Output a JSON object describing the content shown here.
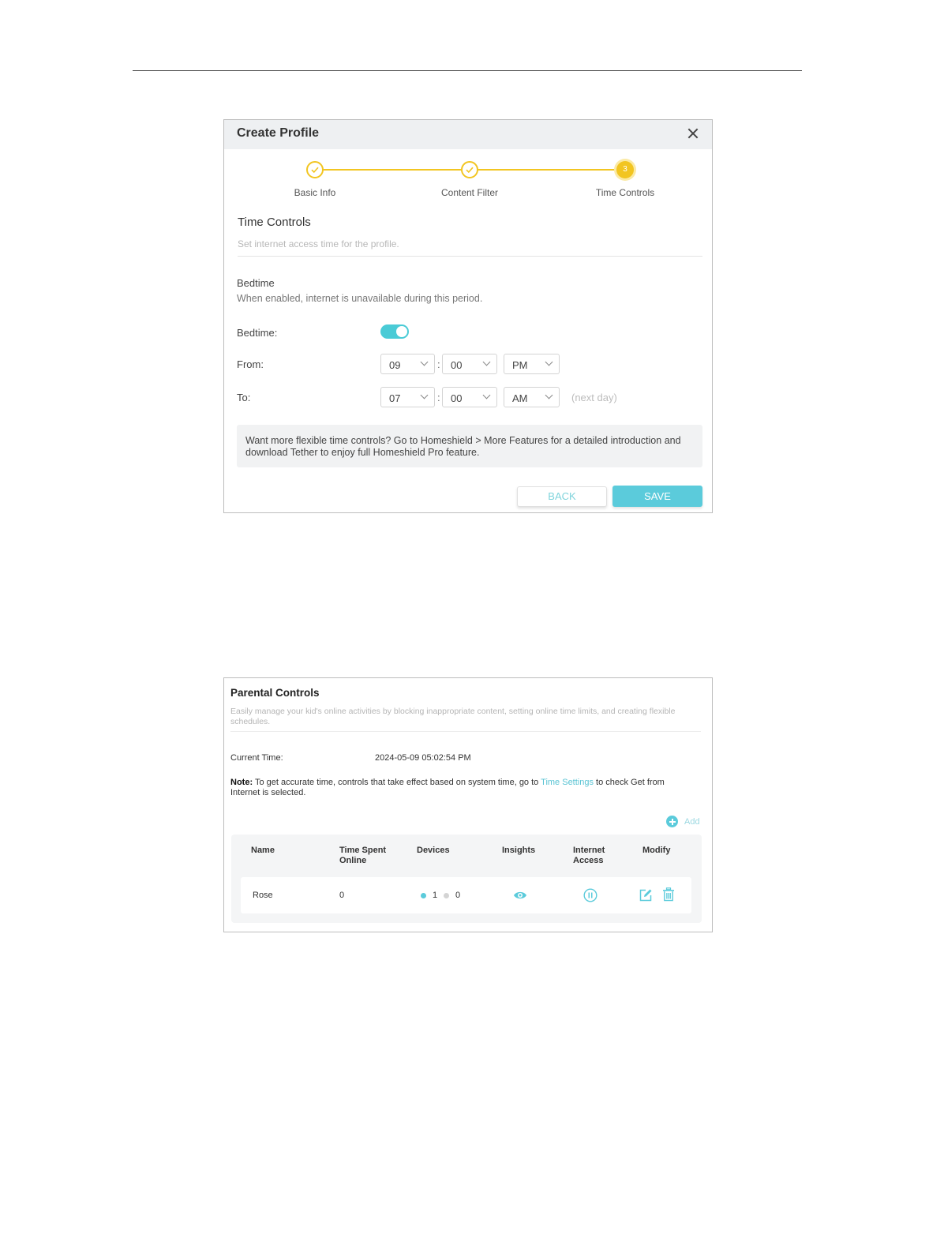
{
  "colors": {
    "accent": "#5bcbdb",
    "step_yellow": "#f2c521",
    "muted_text": "#b7b7b7"
  },
  "create_profile": {
    "title": "Create Profile",
    "steps": [
      {
        "label": "Basic Info",
        "state": "done"
      },
      {
        "label": "Content Filter",
        "state": "done"
      },
      {
        "label": "Time Controls",
        "state": "current",
        "number": "3"
      }
    ],
    "section_title": "Time Controls",
    "section_subtitle": "Set internet access time for the profile.",
    "bedtime_heading": "Bedtime",
    "bedtime_description": "When enabled, internet is unavailable during this period.",
    "bedtime_label": "Bedtime:",
    "bedtime_enabled": true,
    "from_label": "From:",
    "from": {
      "hour": "09",
      "minute": "00",
      "ampm": "PM"
    },
    "to_label": "To:",
    "to": {
      "hour": "07",
      "minute": "00",
      "ampm": "AM"
    },
    "colon": ":",
    "next_day": "(next day)",
    "info": "Want more flexible time controls? Go to Homeshield > More Features for a detailed introduction and download Tether to enjoy full Homeshield Pro feature.",
    "back_label": "BACK",
    "save_label": "SAVE"
  },
  "parental_controls": {
    "title": "Parental Controls",
    "description": "Easily manage your kid's online activities by blocking inappropriate content, setting online time limits, and creating flexible schedules.",
    "current_time_label": "Current Time:",
    "current_time_value": "2024-05-09 05:02:54 PM",
    "note_label": "Note:",
    "note_before": " To get accurate time, controls that take effect based on system time, go to ",
    "note_link": "Time Settings",
    "note_after": " to check Get from Internet is selected.",
    "add_label": "Add",
    "columns": [
      "Name",
      "Time Spent Online",
      "Devices",
      "Insights",
      "Internet Access",
      "Modify"
    ],
    "rows": [
      {
        "name": "Rose",
        "time_spent": "0",
        "devices_online": "1",
        "devices_offline": "0"
      }
    ]
  }
}
